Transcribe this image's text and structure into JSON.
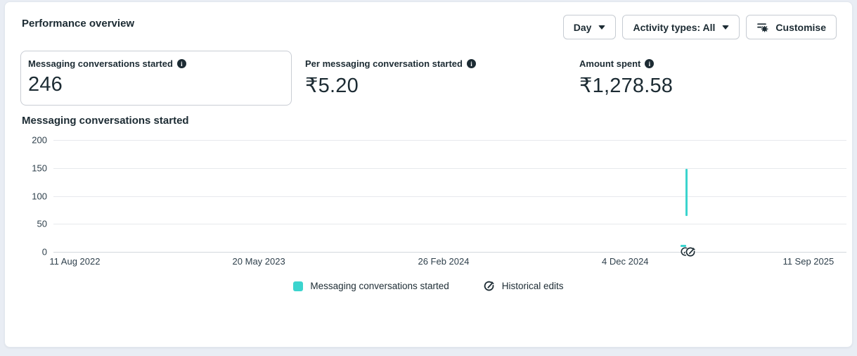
{
  "header": {
    "title": "Performance overview"
  },
  "toolbar": {
    "time_breakdown_label": "Day",
    "activity_types_label": "Activity types: All",
    "customise_label": "Customise"
  },
  "metrics": [
    {
      "label": "Messaging conversations started",
      "value": "246"
    },
    {
      "label": "Per messaging conversation started",
      "value": "₹5.20"
    },
    {
      "label": "Amount spent",
      "value": "₹1,278.58"
    }
  ],
  "chart_data": {
    "type": "line",
    "title": "Messaging conversations started",
    "xlabel": "",
    "ylabel": "",
    "ylim": [
      0,
      200
    ],
    "yticks": [
      200,
      150,
      100,
      50,
      0
    ],
    "xticks": [
      "11 Aug 2022",
      "20 May 2023",
      "26 Feb 2024",
      "4 Dec 2024",
      "11 Sep 2025"
    ],
    "grid": "horizontal",
    "legend_position": "bottom-center",
    "series": [
      {
        "name": "Messaging conversations started",
        "color": "#3bd4ce",
        "visible_segments": [
          {
            "x_frac": 0.798,
            "value_top": 149,
            "value_bottom": 65
          },
          {
            "x_frac": 0.794,
            "value_top": 14,
            "value_bottom": 10,
            "style": "dash"
          }
        ]
      }
    ],
    "historical_edits_marker": {
      "x_frac": 0.801
    }
  },
  "legend": {
    "series_label": "Messaging conversations started",
    "edits_label": "Historical edits"
  },
  "colors": {
    "accent_teal": "#3bd4ce",
    "text_primary": "#1c2b33",
    "page_background": "#e9edf4"
  }
}
